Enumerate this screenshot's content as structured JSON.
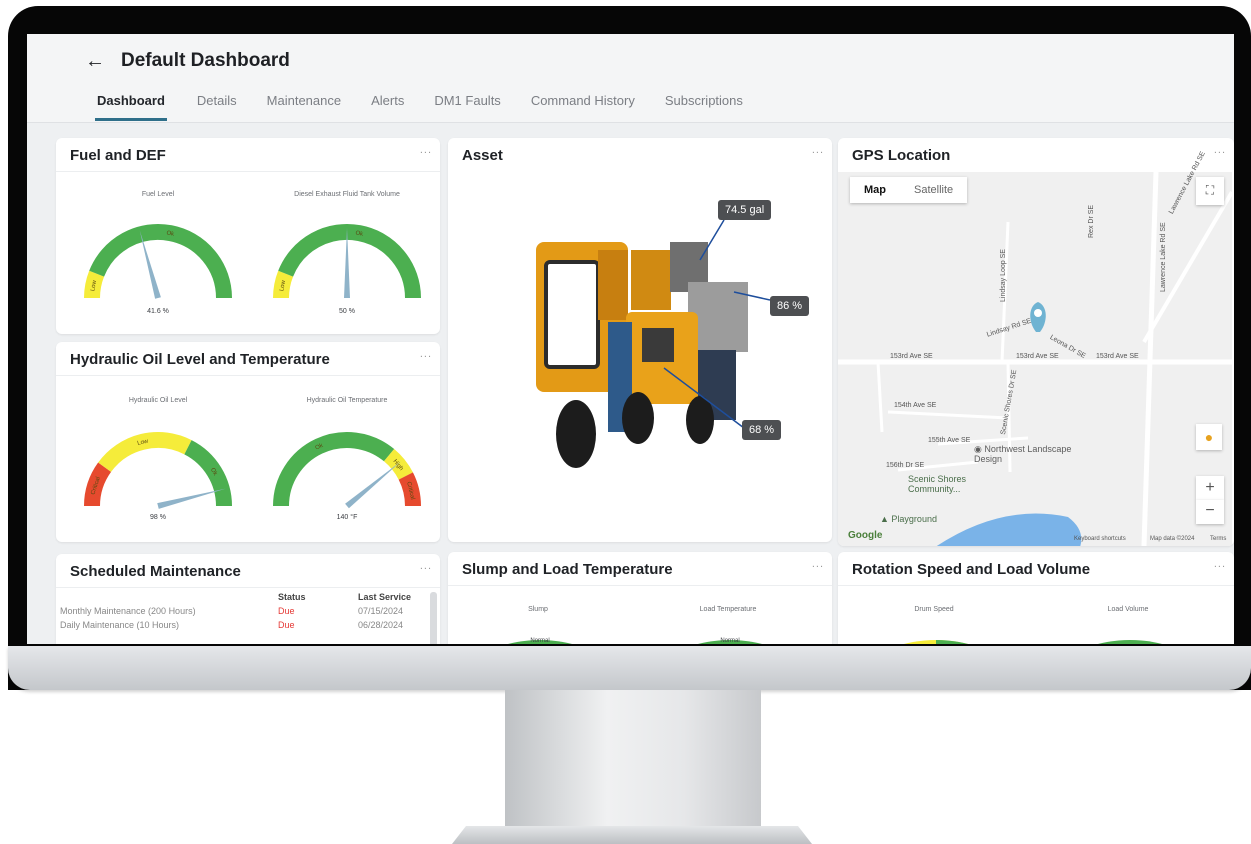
{
  "header": {
    "back_icon": "arrow-left-icon",
    "title": "Default Dashboard",
    "tabs": [
      {
        "label": "Dashboard",
        "active": true
      },
      {
        "label": "Details"
      },
      {
        "label": "Maintenance"
      },
      {
        "label": "Alerts"
      },
      {
        "label": "DM1 Faults"
      },
      {
        "label": "Command History"
      },
      {
        "label": "Subscriptions"
      }
    ]
  },
  "cards": {
    "menu_icon": "...",
    "fuel": {
      "title": "Fuel and DEF",
      "gauges": [
        {
          "label": "Fuel Level",
          "value": "41.6 %",
          "level": 0.416,
          "zones": [
            "Low",
            "Ok"
          ]
        },
        {
          "label": "Diesel Exhaust Fluid Tank Volume",
          "value": "50 %",
          "level": 0.5,
          "zones": [
            "Low",
            "Ok"
          ]
        }
      ]
    },
    "hydraulic": {
      "title": "Hydraulic Oil Level and Temperature",
      "gauges": [
        {
          "label": "Hydraulic Oil Level",
          "value": "98 %",
          "level": 0.92,
          "zones": [
            "Critical",
            "Low",
            "Ok"
          ]
        },
        {
          "label": "Hydraulic Oil Temperature",
          "value": "140 °F",
          "level": 0.78,
          "zones": [
            "Ok",
            "High",
            "Critical"
          ]
        }
      ]
    },
    "asset": {
      "title": "Asset",
      "callouts": [
        "74.5 gal",
        "86 %",
        "68 %"
      ]
    },
    "gps": {
      "title": "GPS Location",
      "map_type": [
        "Map",
        "Satellite"
      ],
      "streets": [
        "153rd Ave SE",
        "153rd Ave SE",
        "153rd Ave SE",
        "Lawrence Lake Rd SE",
        "Lawrence Lake Rd SE",
        "Lindsay Loop SE",
        "Scenic Shores Dr SE",
        "154th Ave SE",
        "155th Ave SE",
        "Lindsay Rd SE",
        "Leona Dr SE",
        "156th Dr SE",
        "Rex Dr SE"
      ],
      "places": [
        "Northwest Landscape Design",
        "Scenic Shores Community...",
        "Playground"
      ],
      "footer": [
        "Keyboard shortcuts",
        "Map data ©2024",
        "Terms"
      ],
      "logo": "Google"
    },
    "maintenance": {
      "title": "Scheduled Maintenance",
      "columns": [
        "Status",
        "Last Service"
      ],
      "rows": [
        {
          "name": "Monthly Maintenance (200 Hours)",
          "status": "Due",
          "date": "07/15/2024"
        },
        {
          "name": "Daily Maintenance (10 Hours)",
          "status": "Due",
          "date": "06/28/2024"
        }
      ]
    },
    "slump": {
      "title": "Slump and Load Temperature",
      "gauges": [
        {
          "label": "Slump",
          "zone": "Normal"
        },
        {
          "label": "Load Temperature",
          "zone": "Normal"
        }
      ]
    },
    "rotation": {
      "title": "Rotation Speed and Load Volume",
      "gauges": [
        {
          "label": "Drum Speed"
        },
        {
          "label": "Load Volume"
        }
      ]
    }
  },
  "colors": {
    "green": "#4caf50",
    "yellow": "#f5ec3a",
    "red": "#e64a2e",
    "needle": "#8fb3c9",
    "tab_underline": "#2f6f8a",
    "due": "#e53935"
  }
}
